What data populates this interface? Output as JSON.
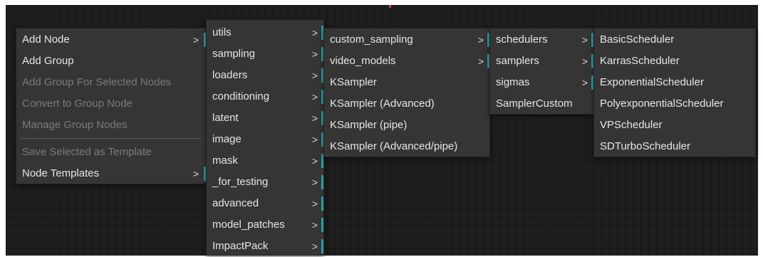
{
  "menus": {
    "main": {
      "items": [
        {
          "label": "Add Node",
          "submenu": true,
          "disabled": false
        },
        {
          "label": "Add Group",
          "submenu": false,
          "disabled": false
        },
        {
          "label": "Add Group For Selected Nodes",
          "submenu": false,
          "disabled": true
        },
        {
          "label": "Convert to Group Node",
          "submenu": false,
          "disabled": true
        },
        {
          "label": "Manage Group Nodes",
          "submenu": false,
          "disabled": true
        },
        {
          "label": "Save Selected as Template",
          "submenu": false,
          "disabled": true
        },
        {
          "label": "Node Templates",
          "submenu": true,
          "disabled": false
        }
      ],
      "arrow": ">"
    },
    "categories": {
      "items": [
        {
          "label": "utils"
        },
        {
          "label": "sampling"
        },
        {
          "label": "loaders"
        },
        {
          "label": "conditioning"
        },
        {
          "label": "latent"
        },
        {
          "label": "image"
        },
        {
          "label": "mask"
        },
        {
          "label": "_for_testing"
        },
        {
          "label": "advanced"
        },
        {
          "label": "model_patches"
        },
        {
          "label": "ImpactPack"
        }
      ],
      "arrow": ">"
    },
    "sampling": {
      "items": [
        {
          "label": "custom_sampling",
          "submenu": true
        },
        {
          "label": "video_models",
          "submenu": true
        },
        {
          "label": "KSampler",
          "submenu": false
        },
        {
          "label": "KSampler (Advanced)",
          "submenu": false
        },
        {
          "label": "KSampler (pipe)",
          "submenu": false
        },
        {
          "label": "KSampler (Advanced/pipe)",
          "submenu": false
        }
      ],
      "arrow": ">"
    },
    "custom_sampling": {
      "items": [
        {
          "label": "schedulers",
          "submenu": true
        },
        {
          "label": "samplers",
          "submenu": true
        },
        {
          "label": "sigmas",
          "submenu": true
        },
        {
          "label": "SamplerCustom",
          "submenu": false
        }
      ],
      "arrow": ">"
    },
    "schedulers": {
      "items": [
        {
          "label": "BasicScheduler"
        },
        {
          "label": "KarrasScheduler"
        },
        {
          "label": "ExponentialScheduler"
        },
        {
          "label": "PolyexponentialScheduler"
        },
        {
          "label": "VPScheduler"
        },
        {
          "label": "SDTurboScheduler"
        }
      ]
    }
  },
  "colors": {
    "canvas": "#1e1e1e",
    "menu_bg": "#353535",
    "submenu_marker": "#2f9fa6",
    "text": "#e6e6e6",
    "disabled_text": "#7a7a7a"
  }
}
